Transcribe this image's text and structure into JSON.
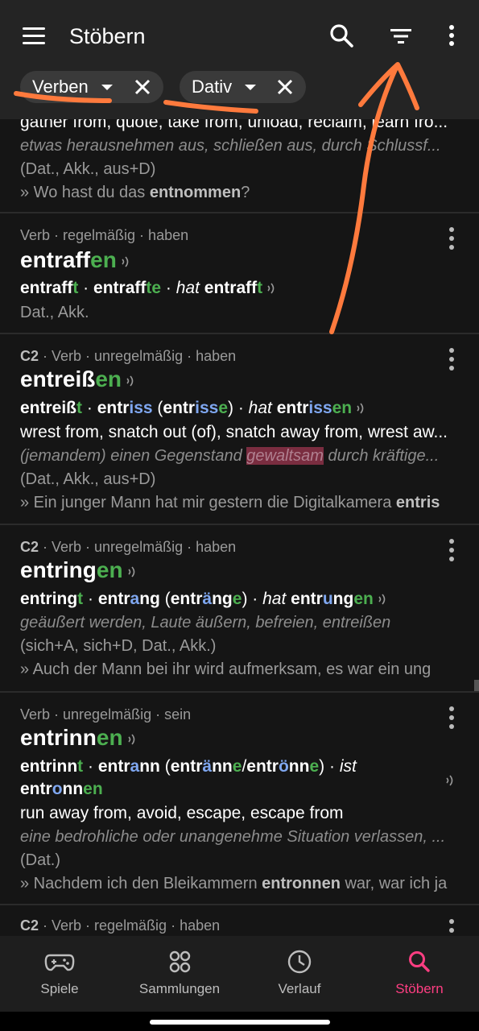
{
  "app": {
    "title": "Stöbern"
  },
  "icons": {
    "menu": "menu-icon",
    "search": "search-icon",
    "filter": "filter-icon",
    "more": "more-vert-icon",
    "audio": "audio-icon",
    "close": "close-icon",
    "caret": "caret-down-icon"
  },
  "colors": {
    "ending": "#4caf50",
    "vowel": "#7fa7f0",
    "highlight": "#7a2d40",
    "accent": "#ff3e82",
    "annotation": "#ff7a3d"
  },
  "filters": [
    {
      "label": "Verben"
    },
    {
      "label": "Dativ"
    }
  ],
  "entry0": {
    "translation": "gather from, quote, take from, unload, reclaim, learn fro...",
    "definition": "etwas herausnehmen aus, schließen aus, durch Schlussf...",
    "grammar": "(Dat., Akk., aus+D)",
    "example_pre": "» Wo hast du das ",
    "example_bold": "entnommen",
    "example_post": "?"
  },
  "entry1": {
    "meta": "Verb · regelmäßig · haben",
    "hw_stem": "entraff",
    "hw_end": "en",
    "c1_stem": "entraff",
    "c1_end": "t",
    "c2_stem": "entraff",
    "c2_end": "te",
    "c3_aux": "hat",
    "c3_stem": "entraff",
    "c3_end": "t",
    "sep": " · ",
    "grammar": "Dat., Akk."
  },
  "entry2": {
    "level": "C2",
    "meta": " · Verb · unregelmäßig · haben",
    "hw_stem": "entreiß",
    "hw_end": "en",
    "c1_stem": "entreiß",
    "c1_end": "t",
    "c2_a": "entr",
    "c2_b": "iss",
    "c2_c": "entr",
    "c2_d": "iss",
    "c2_e": "e",
    "c3_aux": "hat",
    "c3_a": "entr",
    "c3_b": "iss",
    "c3_c": "en",
    "translation": "wrest from, snatch out (of), snatch away from, wrest aw...",
    "def_pre": "(jemandem) einen Gegenstand ",
    "def_hl": "gewaltsam",
    "def_post": " durch kräftige...",
    "grammar": "(Dat., Akk., aus+D)",
    "example_pre": "» Ein junger Mann hat mir gestern die Digitalkamera ",
    "example_bold": "entris"
  },
  "entry3": {
    "level": "C2",
    "meta": " · Verb · unregelmäßig · haben",
    "hw_stem": "entring",
    "hw_end": "en",
    "c1_stem": "entring",
    "c1_end": "t",
    "c2_a": "entr",
    "c2_b": "a",
    "c2_c": "ng",
    "c2_d": "entr",
    "c2_e": "ä",
    "c2_f": "ng",
    "c2_g": "e",
    "c3_aux": "hat",
    "c3_a": "entr",
    "c3_b": "u",
    "c3_c": "ng",
    "c3_d": "en",
    "definition": "geäußert werden, Laute äußern, befreien, entreißen",
    "grammar": "(sich+A, sich+D, Dat., Akk.)",
    "example": "» Auch der Mann bei ihr wird aufmerksam, es war ein ung"
  },
  "entry4": {
    "meta": "Verb · unregelmäßig · sein",
    "hw_stem": "entrinn",
    "hw_end": "en",
    "c1_stem": "entrinn",
    "c1_end": "t",
    "c2_a": "entr",
    "c2_b": "a",
    "c2_c": "nn",
    "c2_d": "entr",
    "c2_e": "ä",
    "c2_f": "nn",
    "c2_g": "e",
    "c2_slash": "/",
    "c2_h": "entr",
    "c2_i": "ö",
    "c2_j": "nn",
    "c2_k": "e",
    "c3_aux": "ist",
    "c3_a": "entr",
    "c3_b": "o",
    "c3_c": "nn",
    "c3_d": "en",
    "translation": "run away from, avoid, escape, escape from",
    "definition": "eine bedrohliche oder unangenehme Situation verlassen, ...",
    "grammar": "(Dat.)",
    "example_pre": "» Nachdem ich den Bleikammern ",
    "example_bold": "entronnen",
    "example_post": " war, war ich ja"
  },
  "entry5": {
    "level": "C2",
    "meta": " · Verb · regelmäßig · haben"
  },
  "nav": [
    {
      "label": "Spiele",
      "icon": "gamepad-icon"
    },
    {
      "label": "Sammlungen",
      "icon": "grid-icon"
    },
    {
      "label": "Verlauf",
      "icon": "clock-icon"
    },
    {
      "label": "Stöbern",
      "icon": "search-icon"
    }
  ]
}
